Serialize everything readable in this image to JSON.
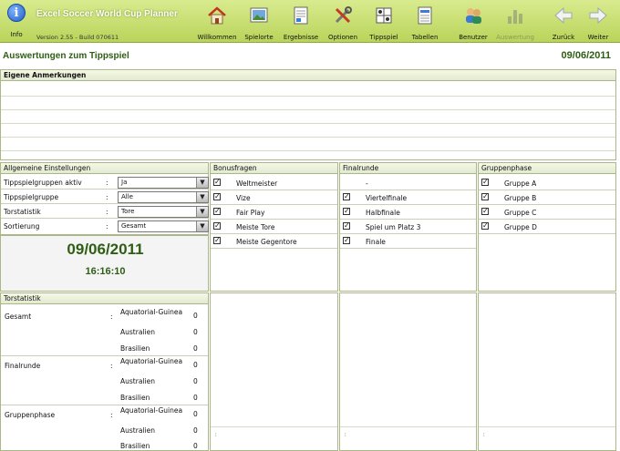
{
  "app": {
    "title": "Excel Soccer World Cup Planner",
    "version": "Version 2.55 - Build 070611",
    "info_label": "Info"
  },
  "toolbar": {
    "buttons": [
      {
        "label": "Willkommen",
        "icon": "house-icon"
      },
      {
        "label": "Spielorte",
        "icon": "picture-icon"
      },
      {
        "label": "Ergebnisse",
        "icon": "results-icon"
      },
      {
        "label": "Optionen",
        "icon": "tools-icon"
      },
      {
        "label": "Tippspiel",
        "icon": "grid-icon"
      },
      {
        "label": "Tabellen",
        "icon": "table-icon"
      },
      {
        "label": "Benutzer",
        "icon": "users-icon"
      },
      {
        "label": "Auswertung",
        "icon": "chart-icon",
        "disabled": true
      },
      {
        "label": "Zurück",
        "icon": "arrow-left-icon"
      },
      {
        "label": "Weiter",
        "icon": "arrow-right-icon"
      }
    ]
  },
  "header": {
    "title": "Auswertungen zum Tippspiel",
    "date": "09/06/2011"
  },
  "notes": {
    "title": "Eigene Anmerkungen"
  },
  "settings": {
    "title": "Allgemeine Einstellungen",
    "rows": [
      {
        "label": "Tippspielgruppen aktiv",
        "value": "Ja"
      },
      {
        "label": "Tippspielgruppe",
        "value": "Alle"
      },
      {
        "label": "Torstatistik",
        "value": "Tore"
      },
      {
        "label": "Sortierung",
        "value": "Gesamt"
      }
    ],
    "colon": ":"
  },
  "clock": {
    "date": "09/06/2011",
    "time": "16:16:10"
  },
  "bonus": {
    "title": "Bonusfragen",
    "items": [
      "Weltmeister",
      "Vize",
      "Fair Play",
      "Meiste Tore",
      "Meiste Gegentore"
    ]
  },
  "final_round": {
    "title": "Finalrunde",
    "first": "-",
    "items": [
      "Viertelfinale",
      "Halbfinale",
      "Spiel um Platz 3",
      "Finale"
    ]
  },
  "group_phase": {
    "title": "Gruppenphase",
    "items": [
      "Gruppe A",
      "Gruppe B",
      "Gruppe C",
      "Gruppe D"
    ]
  },
  "goal_stats": {
    "title": "Torstatistik",
    "colon": ":",
    "sections": [
      {
        "label": "Gesamt",
        "teams": [
          {
            "name": "Aquatorial-Guinea",
            "value": "0"
          },
          {
            "name": "Australien",
            "value": "0"
          },
          {
            "name": "Brasilien",
            "value": "0"
          }
        ]
      },
      {
        "label": "Finalrunde",
        "teams": [
          {
            "name": "Aquatorial-Guinea",
            "value": "0"
          },
          {
            "name": "Australien",
            "value": "0"
          },
          {
            "name": "Brasilien",
            "value": "0"
          }
        ]
      },
      {
        "label": "Gruppenphase",
        "teams": [
          {
            "name": "Aquatorial-Guinea",
            "value": "0"
          },
          {
            "name": "Australien",
            "value": "0"
          },
          {
            "name": "Brasilien",
            "value": "0"
          }
        ]
      }
    ]
  },
  "colors": {
    "accent": "#2e5d14",
    "toolbar": "#c6dd6e",
    "border": "#a9b886"
  }
}
